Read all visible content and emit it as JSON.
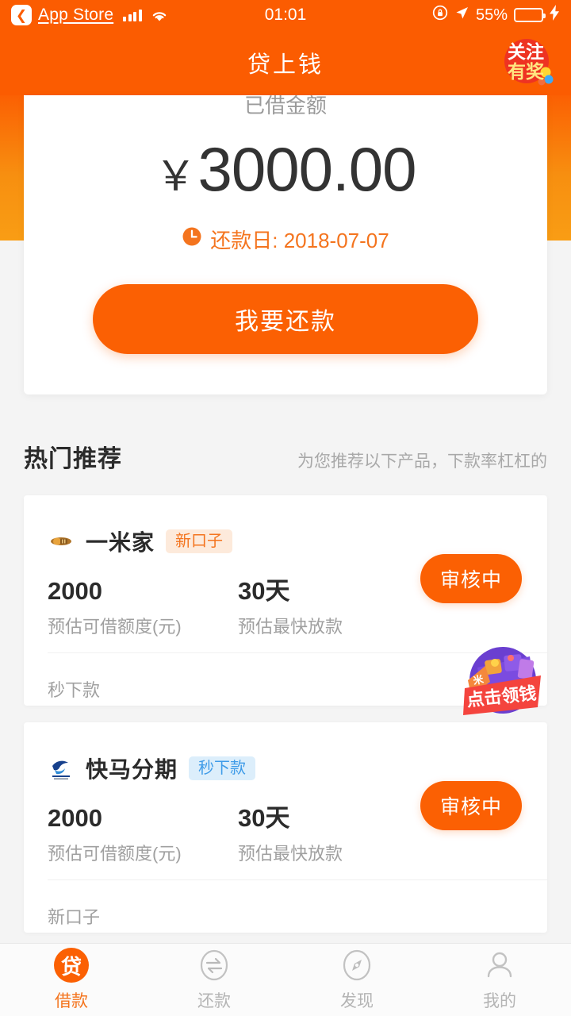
{
  "status_bar": {
    "back_icon": "back-chevron-icon",
    "carrier_label": "App Store",
    "signal_icon": "cellular-signal-icon",
    "wifi_icon": "wifi-icon",
    "time": "01:01",
    "rotation_lock_icon": "rotation-lock-icon",
    "location_icon": "location-arrow-icon",
    "battery_percent": "55%",
    "battery_level": 55,
    "battery_icon": "battery-icon",
    "charging_icon": "lightning-bolt-icon"
  },
  "header": {
    "title": "贷上钱",
    "follow_badge": {
      "name": "follow-reward-badge",
      "line1": "关注",
      "line2": "有奖"
    }
  },
  "balance_card": {
    "label": "已借金额",
    "currency_symbol": "￥",
    "amount": "3000.00",
    "due_icon": "clock-icon",
    "due_text": "还款日: 2018-07-07",
    "repay_button_label": "我要还款"
  },
  "recommend_section": {
    "title": "热门推荐",
    "subtitle": "为您推荐以下产品，下款率杠杠的"
  },
  "products": [
    {
      "logo_icon": "yimijia-logo-icon",
      "name": "一米家",
      "tag": "新口子",
      "tag_type": "new",
      "amount_value": "2000",
      "amount_label": "预估可借额度(元)",
      "term_value": "30天",
      "term_label": "预估最快放款",
      "action_label": "审核中",
      "footer_note": "秒下款"
    },
    {
      "logo_icon": "kuaimafenqi-logo-icon",
      "name": "快马分期",
      "tag": "秒下款",
      "tag_type": "fast",
      "amount_value": "2000",
      "amount_label": "预估可借额度(元)",
      "term_value": "30天",
      "term_label": "预估最快放款",
      "action_label": "审核中",
      "footer_note": "新口子"
    }
  ],
  "promo_badge": {
    "name": "click-to-claim-money-badge",
    "label": "点击领钱"
  },
  "tab_bar": {
    "items": [
      {
        "icon": "loan-icon",
        "glyph": "贷",
        "label": "借款",
        "active": true
      },
      {
        "icon": "repay-icon",
        "glyph": "",
        "label": "还款",
        "active": false
      },
      {
        "icon": "discover-icon",
        "glyph": "",
        "label": "发现",
        "active": false
      },
      {
        "icon": "profile-icon",
        "glyph": "",
        "label": "我的",
        "active": false
      }
    ]
  },
  "colors": {
    "brand_orange": "#FB5C01",
    "button_orange": "#FB6003",
    "accent_orange": "#F4741E",
    "tag_new_bg": "#FDEADB",
    "tag_fast_bg": "#DCEEFB",
    "tag_fast_text": "#3E9BE8",
    "page_bg": "#F4F4F4",
    "battery_green": "#4CD55C"
  }
}
